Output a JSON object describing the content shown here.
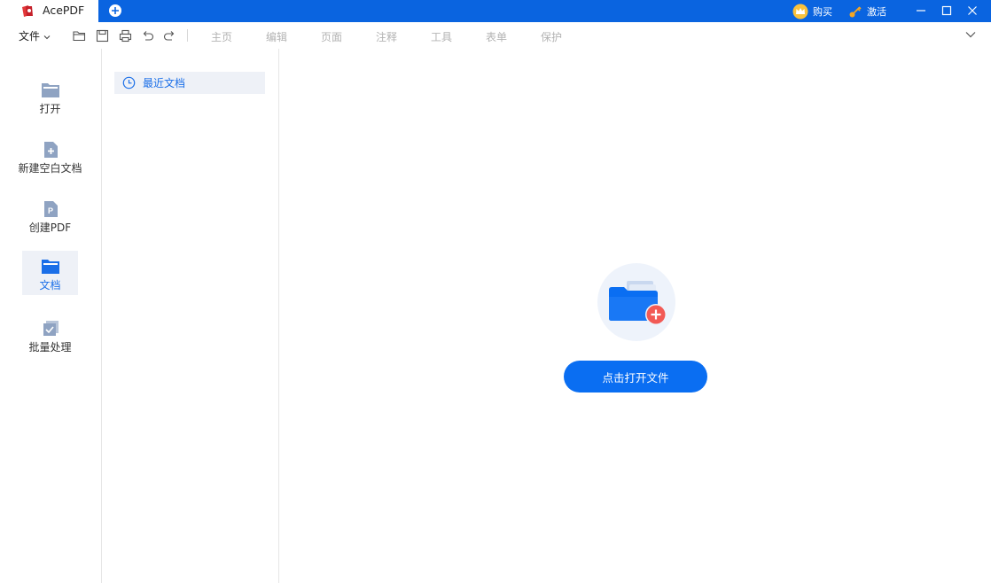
{
  "app": {
    "tab_title": "AcePDF",
    "buy_label": "购买",
    "activate_label": "激活"
  },
  "toolbar": {
    "file_menu": "文件",
    "ribbon_tabs": [
      "主页",
      "编辑",
      "页面",
      "注释",
      "工具",
      "表单",
      "保护"
    ]
  },
  "nav": {
    "items": [
      {
        "label": "打开",
        "icon": "folder-icon"
      },
      {
        "label": "新建空白文档",
        "icon": "new-doc-icon"
      },
      {
        "label": "创建PDF",
        "icon": "create-pdf-icon"
      },
      {
        "label": "文档",
        "icon": "documents-icon",
        "active": true
      },
      {
        "label": "批量处理",
        "icon": "batch-icon"
      }
    ]
  },
  "subpanel": {
    "recent_label": "最近文档"
  },
  "main": {
    "open_button": "点击打开文件"
  },
  "colors": {
    "titlebar": "#0a64e0",
    "accent": "#0a6ef2",
    "active_text": "#1b6fe8",
    "plus_badge": "#f25a55"
  }
}
